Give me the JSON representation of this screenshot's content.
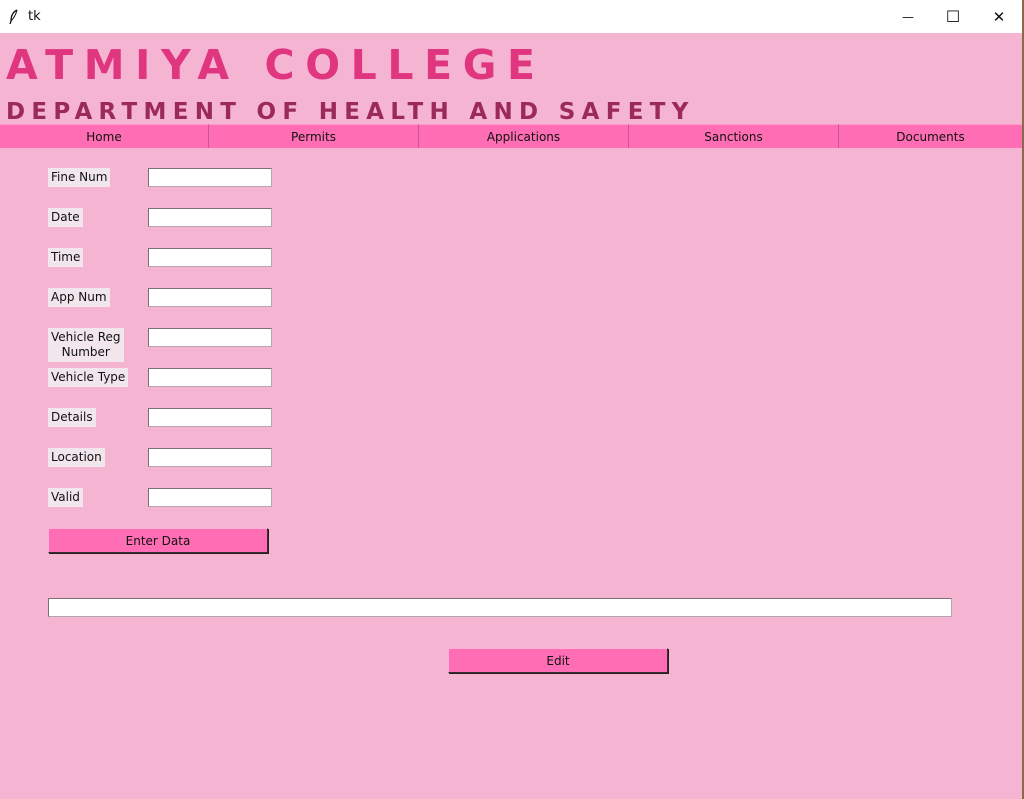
{
  "window": {
    "title": "tk",
    "minimize": "—",
    "maximize": "☐",
    "close": "✕"
  },
  "header": {
    "college": "ATMIYA COLLEGE",
    "department": "DEPARTMENT OF HEALTH AND SAFETY"
  },
  "nav": [
    {
      "label": "Home"
    },
    {
      "label": "Permits"
    },
    {
      "label": "Applications"
    },
    {
      "label": "Sanctions"
    },
    {
      "label": "Documents"
    }
  ],
  "form": {
    "fields": [
      {
        "label": "Fine Num",
        "value": ""
      },
      {
        "label": "Date",
        "value": ""
      },
      {
        "label": "Time",
        "value": ""
      },
      {
        "label": "App Num",
        "value": ""
      },
      {
        "label": "Vehicle Reg Number",
        "label_line1": "Vehicle Reg",
        "label_line2": "Number",
        "value": ""
      },
      {
        "label": "Vehicle Type",
        "value": ""
      },
      {
        "label": "Details",
        "value": ""
      },
      {
        "label": "Location",
        "value": ""
      },
      {
        "label": "Valid",
        "value": ""
      }
    ],
    "enter_button": "Enter Data"
  },
  "edit": {
    "entry_value": "",
    "button": "Edit"
  },
  "colors": {
    "background": "#f5b5d2",
    "accent": "#ff6eb4",
    "title": "#e0357f",
    "subtitle": "#9b2a58"
  }
}
